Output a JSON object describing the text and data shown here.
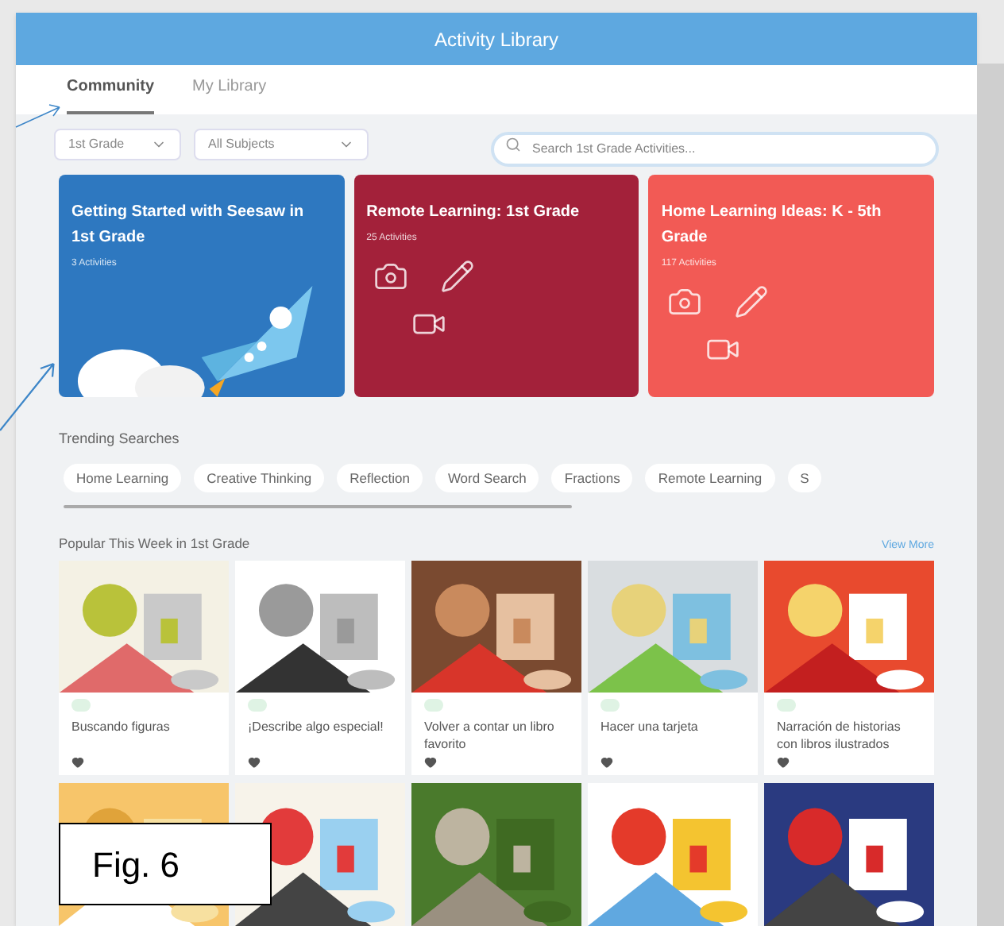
{
  "header": {
    "title": "Activity Library"
  },
  "tabs": [
    {
      "label": "Community",
      "selected": true
    },
    {
      "label": "My Library",
      "selected": false
    }
  ],
  "filters": [
    {
      "value": "1st Grade"
    },
    {
      "value": "All Subjects"
    }
  ],
  "search": {
    "placeholder": "Search 1st Grade Activities..."
  },
  "collections": [
    {
      "title": "Getting Started with Seesaw in 1st Grade",
      "count": "3 Activities",
      "color": "#2e78c0",
      "kind": "rocket"
    },
    {
      "title": "Remote Learning: 1st Grade",
      "count": "25 Activities",
      "color": "#a3213a",
      "kind": "tools"
    },
    {
      "title": "Home Learning Ideas: K - 5th Grade",
      "count": "117 Activities",
      "color": "#f25a55",
      "kind": "tools"
    }
  ],
  "trending": {
    "title": "Trending Searches",
    "chips": [
      "Home Learning",
      "Creative Thinking",
      "Reflection",
      "Word Search",
      "Fractions",
      "Remote Learning",
      "S"
    ]
  },
  "popular": {
    "title": "Popular This Week in 1st Grade",
    "link": "View More",
    "activities": [
      {
        "title": "Buscando figuras"
      },
      {
        "title": "¡Describe algo especial!"
      },
      {
        "title": "Volver a contar un libro favorito"
      },
      {
        "title": "Hacer una tarjeta"
      },
      {
        "title": "Narración de historias con libros ilustrados"
      }
    ]
  },
  "figure_label": "Fig. 6"
}
